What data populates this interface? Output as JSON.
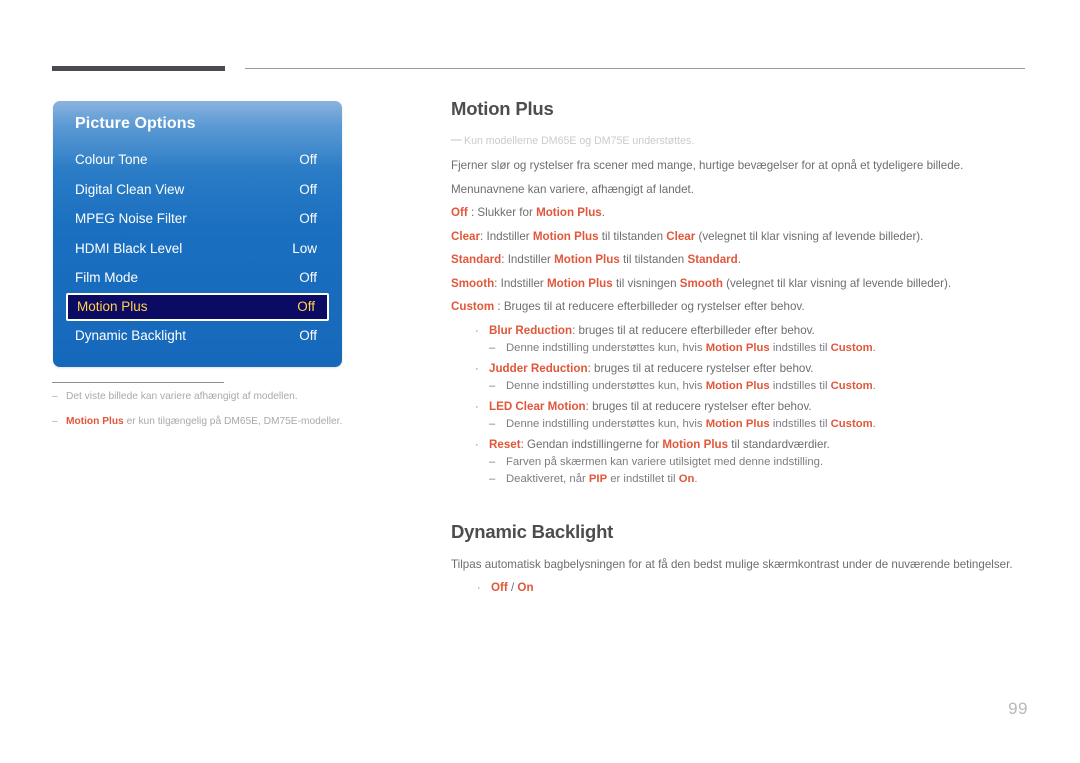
{
  "header": {
    "thick_rule_color": "#4a4a55",
    "thin_rule_color": "#9a9a9e"
  },
  "osd_panel": {
    "title": "Picture Options",
    "accent_selected_bg": "#0b0b63",
    "accent_selected_text": "#ffd34d",
    "rows": [
      {
        "label": "Colour Tone",
        "value": "Off",
        "selected": false
      },
      {
        "label": "Digital Clean View",
        "value": "Off",
        "selected": false
      },
      {
        "label": "MPEG Noise Filter",
        "value": "Off",
        "selected": false
      },
      {
        "label": "HDMI Black Level",
        "value": "Low",
        "selected": false
      },
      {
        "label": "Film Mode",
        "value": "Off",
        "selected": false
      },
      {
        "label": "Motion Plus",
        "value": "Off",
        "selected": true
      },
      {
        "label": "Dynamic Backlight",
        "value": "Off",
        "selected": false
      }
    ]
  },
  "left_notes": [
    {
      "dash": "–",
      "text": "Det viste billede kan variere afhængigt af modellen.",
      "keyword": ""
    },
    {
      "dash": "–",
      "keyword": "Motion Plus",
      "text": " er kun tilgængelig på DM65E, DM75E-modeller."
    }
  ],
  "sections": {
    "motion_plus": {
      "title": "Motion Plus",
      "faint_note": {
        "dash": "―",
        "text": "Kun modellerne DM65E og DM75E understøttes."
      },
      "paragraphs": [
        "Fjerner slør og rystelser fra scener med mange, hurtige bevægelser for at opnå et tydeligere billede.",
        "Menunavnene kan variere, afhængigt af landet."
      ],
      "options": [
        {
          "kw": "Off",
          "sep": " : ",
          "rest_a": "Slukker for ",
          "kw2": "Motion Plus",
          "rest_b": "."
        },
        {
          "kw": "Clear",
          "sep": ": ",
          "rest_a": "Indstiller ",
          "kw2": "Motion Plus",
          "rest_b": " til tilstanden ",
          "kw3": "Clear",
          "rest_c": " (velegnet til klar visning af levende billeder)."
        },
        {
          "kw": "Standard",
          "sep": ": ",
          "rest_a": "Indstiller ",
          "kw2": "Motion Plus",
          "rest_b": " til tilstanden ",
          "kw3": "Standard",
          "rest_c": "."
        },
        {
          "kw": "Smooth",
          "sep": ": ",
          "rest_a": "Indstiller ",
          "kw2": "Motion Plus",
          "rest_b": " til visningen ",
          "kw3": "Smooth",
          "rest_c": " (velegnet til klar visning af levende billeder)."
        },
        {
          "kw": "Custom",
          "sep": " : ",
          "rest_a": "Bruges til at reducere efterbilleder og rystelser efter behov."
        }
      ],
      "custom_items": [
        {
          "bullet": "·",
          "kw": "Blur Reduction",
          "text": ": bruges til at reducere efterbilleder efter behov.",
          "subs": [
            {
              "dash": "–",
              "pre": "Denne indstilling understøttes kun, hvis ",
              "kw": "Motion Plus",
              "mid": " indstilles til ",
              "kw2": "Custom",
              "post": "."
            }
          ]
        },
        {
          "bullet": "·",
          "kw": "Judder Reduction",
          "text": ": bruges til at reducere rystelser efter behov.",
          "subs": [
            {
              "dash": "–",
              "pre": "Denne indstilling understøttes kun, hvis ",
              "kw": "Motion Plus",
              "mid": " indstilles til ",
              "kw2": "Custom",
              "post": "."
            }
          ]
        },
        {
          "bullet": "·",
          "kw": "LED Clear Motion",
          "text": ": bruges til at reducere rystelser efter behov.",
          "subs": [
            {
              "dash": "–",
              "pre": "Denne indstilling understøttes kun, hvis ",
              "kw": "Motion Plus",
              "mid": " indstilles til ",
              "kw2": "Custom",
              "post": "."
            }
          ]
        },
        {
          "bullet": "·",
          "kw": "Reset",
          "text": ": Gendan indstillingerne for ",
          "kw_inline": "Motion Plus",
          "text_tail": " til standardværdier.",
          "subs": [
            {
              "dash": "–",
              "pre": "Farven på skærmen kan variere utilsigtet med denne indstilling."
            },
            {
              "dash": "–",
              "pre": "Deaktiveret, når ",
              "kw": "PIP",
              "mid": " er indstillet til ",
              "kw2": "On",
              "post": "."
            }
          ]
        }
      ]
    },
    "dynamic_backlight": {
      "title": "Dynamic Backlight",
      "paragraph": "Tilpas automatisk bagbelysningen for at få den bedst mulige skærmkontrast under de nuværende betingelser.",
      "option": {
        "bullet": "·",
        "kw1": "Off",
        "sep": " / ",
        "kw2": "On"
      }
    }
  },
  "footer": {
    "page_number": "99"
  }
}
